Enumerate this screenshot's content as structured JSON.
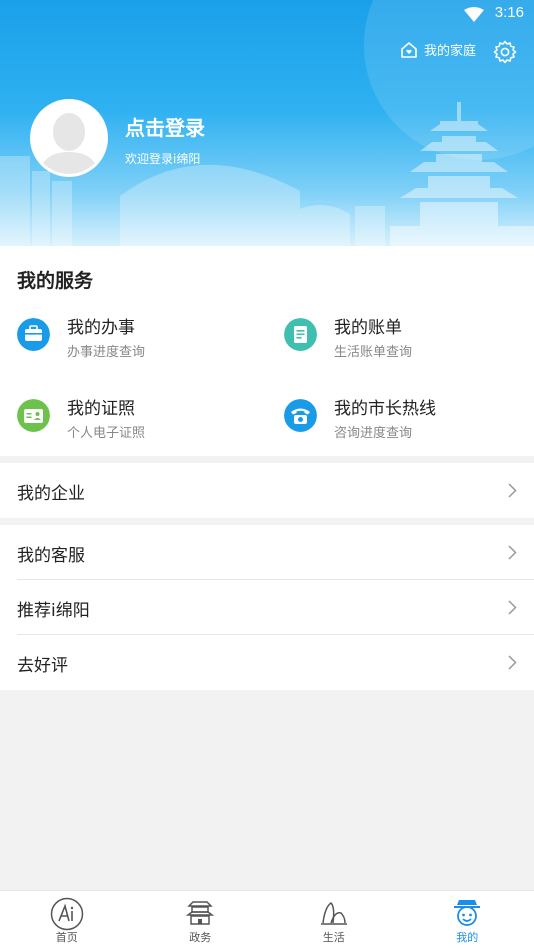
{
  "status": {
    "time": "3:16"
  },
  "header": {
    "family_label": "我的家庭",
    "login_title": "点击登录",
    "login_subtitle": "欢迎登录i绵阳"
  },
  "services": {
    "title": "我的服务",
    "items": [
      {
        "name": "我的办事",
        "desc": "办事进度查询",
        "icon": "briefcase-icon",
        "color": "#1a9be8"
      },
      {
        "name": "我的账单",
        "desc": "生活账单查询",
        "icon": "bill-icon",
        "color": "#3fbfb0"
      },
      {
        "name": "我的证照",
        "desc": "个人电子证照",
        "icon": "id-card-icon",
        "color": "#6cc24a"
      },
      {
        "name": "我的市长热线",
        "desc": "咨询进度查询",
        "icon": "phone-icon",
        "color": "#1a9be8"
      }
    ]
  },
  "menu": {
    "enterprise": "我的企业",
    "customer_service": "我的客服",
    "recommend": "推荐i绵阳",
    "rate": "去好评"
  },
  "nav": {
    "tabs": [
      {
        "label": "首页",
        "icon": "home-ai-icon"
      },
      {
        "label": "政务",
        "icon": "government-icon"
      },
      {
        "label": "生活",
        "icon": "life-icon"
      },
      {
        "label": "我的",
        "icon": "profile-icon",
        "active": true
      }
    ]
  }
}
